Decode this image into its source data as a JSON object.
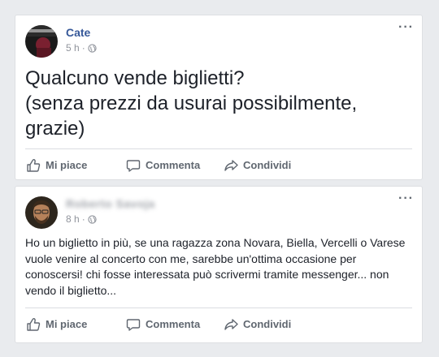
{
  "posts": [
    {
      "author": "Cate",
      "time": "5 h",
      "separator": "·",
      "text": "Qualcuno vende biglietti?\n(senza prezzi da usurai possibilmente, grazie)",
      "actions": {
        "like": "Mi piace",
        "comment": "Commenta",
        "share": "Condividi"
      },
      "more": "···"
    },
    {
      "author": "Roberto Savoja",
      "time": "8 h",
      "separator": "·",
      "text": "Ho un biglietto in più, se una ragazza zona Novara, Biella, Vercelli o Varese vuole venire al concerto con me, sarebbe un'ottima occasione per conoscersi! chi fosse interessata può scrivermi tramite messenger... non vendo il biglietto...",
      "actions": {
        "like": "Mi piace",
        "comment": "Commenta",
        "share": "Condividi"
      },
      "more": "···"
    }
  ],
  "colors": {
    "author": "#365899",
    "meta": "#90949c",
    "action": "#606770",
    "background": "#e9ebee"
  },
  "icons": {
    "like": "thumbs-up-icon",
    "comment": "comment-bubble-icon",
    "share": "share-arrow-icon",
    "privacy": "globe-icon",
    "more": "more-options-icon"
  }
}
